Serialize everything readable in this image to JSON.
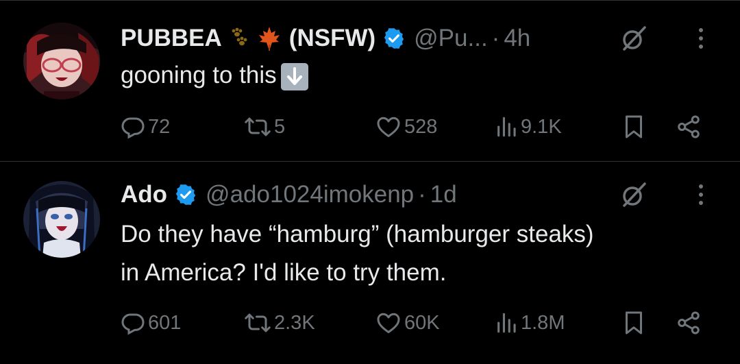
{
  "tweets": [
    {
      "name": "PUBBEA",
      "name_suffix": "(NSFW)",
      "name_emojis": [
        "paw-prints-emoji",
        "maple-leaf-emoji"
      ],
      "handle": "@Pu...",
      "time": "4h",
      "text": "gooning to this",
      "text_emoji": "down-arrow-emoji",
      "stats": {
        "replies": "72",
        "reposts": "5",
        "likes": "528",
        "views": "9.1K"
      }
    },
    {
      "name": "Ado",
      "handle": "@ado1024imokenp",
      "time": "1d",
      "text_lines": [
        "Do they have “hamburg” (hamburger steaks)",
        "in America? I'd like to try them."
      ],
      "stats": {
        "replies": "601",
        "reposts": "2.3K",
        "likes": "60K",
        "views": "1.8M"
      }
    }
  ],
  "separator": "·",
  "colors": {
    "verified": "#1d9bf0",
    "muted": "#71767b",
    "text": "#e7e9ea",
    "divider": "#2f3336"
  },
  "icons": [
    "reply-icon",
    "repost-icon",
    "like-icon",
    "views-icon",
    "bookmark-icon",
    "share-icon",
    "grok-icon",
    "more-icon"
  ]
}
